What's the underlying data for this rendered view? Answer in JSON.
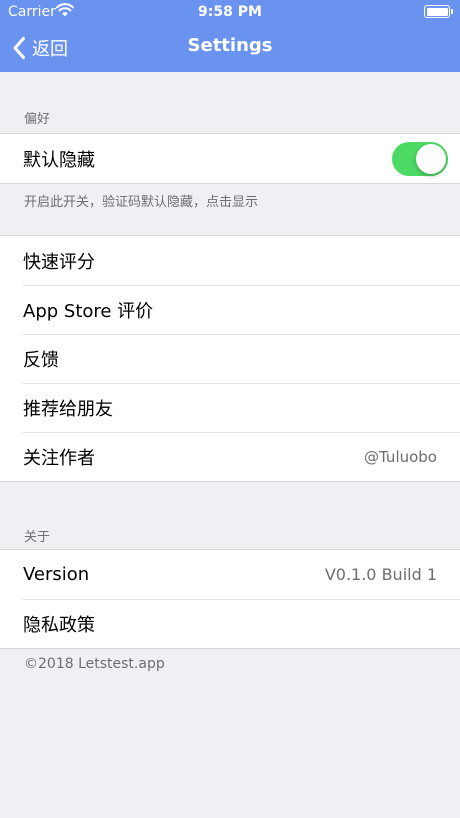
{
  "status_bar": {
    "carrier": "Carrier",
    "time": "9:58 PM"
  },
  "nav": {
    "back_label": "返回",
    "title": "Settings"
  },
  "preferences": {
    "header": "偏好",
    "default_hide_label": "默认隐藏",
    "default_hide_on": true,
    "footer": "开启此开关，验证码默认隐藏，点击显示"
  },
  "general": {
    "items": [
      {
        "label": "快速评分",
        "detail": ""
      },
      {
        "label": "App Store 评价",
        "detail": ""
      },
      {
        "label": "反馈",
        "detail": ""
      },
      {
        "label": "推荐给朋友",
        "detail": ""
      },
      {
        "label": "关注作者",
        "detail": "@Tuluobo"
      }
    ]
  },
  "about": {
    "header": "关于",
    "version_label": "Version",
    "version_value": "V0.1.0 Build 1",
    "privacy_label": "隐私政策",
    "copyright": "©2018 Letstest.app"
  },
  "colors": {
    "nav_background": "#6a93f0",
    "toggle_on": "#4cd964",
    "page_background": "#efeff4"
  }
}
